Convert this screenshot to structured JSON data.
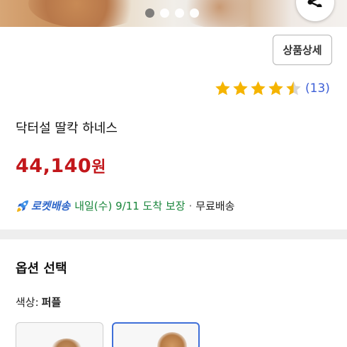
{
  "gallery": {
    "dots": [
      {
        "active": true
      },
      {
        "active": false
      },
      {
        "active": false
      },
      {
        "active": false
      }
    ],
    "share_icon": "share-icon"
  },
  "header": {
    "detail_button_label": "상품상세"
  },
  "rating": {
    "stars": 4.5,
    "count_label": "(13)",
    "star_color": "#f5b400"
  },
  "product": {
    "title": "닥터설 딸칵 하네스",
    "price": "44,140",
    "currency": "원",
    "price_color": "#c2171b"
  },
  "delivery": {
    "icon": "rocket-icon",
    "badge_label": "로켓배송",
    "eta_text": "내일(수) 9/11 도착 보장",
    "separator": "·",
    "shipping_text": "무료배송",
    "badge_color": "#2e66c9",
    "eta_color": "#18853a"
  },
  "options": {
    "section_title": "옵션 선택",
    "color_label": "색상:",
    "color_value": "퍼플",
    "selected_index": 1,
    "selected_border_color": "#3f6fd8"
  }
}
